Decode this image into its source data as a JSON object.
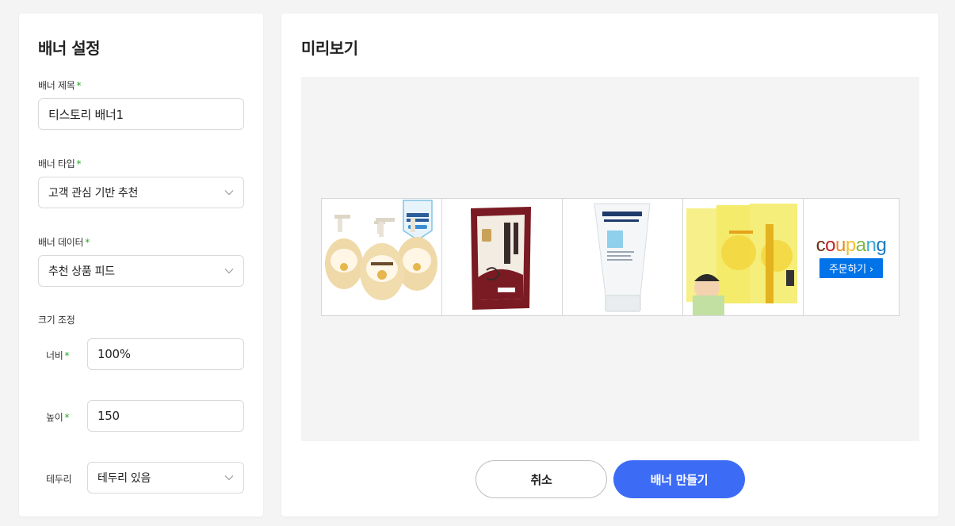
{
  "settings": {
    "title": "배너 설정",
    "banner_title": {
      "label": "배너 제목",
      "required": "*",
      "value": "티스토리 배너1"
    },
    "banner_type": {
      "label": "배너 타입",
      "required": "*",
      "value": "고객 관심 기반 추천"
    },
    "banner_data": {
      "label": "배너 데이터",
      "required": "*",
      "value": "추천 상품 피드"
    },
    "size": {
      "label": "크기 조정",
      "width": {
        "label": "너비",
        "required": "*",
        "value": "100%"
      },
      "height": {
        "label": "높이",
        "required": "*",
        "value": "150"
      }
    },
    "border": {
      "label": "테두리",
      "value": "테두리 있음"
    }
  },
  "preview": {
    "title": "미리보기",
    "products": [
      {
        "icon": "hand-soap-product-image"
      },
      {
        "icon": "rice-bag-product-image"
      },
      {
        "icon": "face-cream-tube-product-image"
      },
      {
        "icon": "supplement-box-product-image"
      }
    ],
    "brand": {
      "logo_letters": [
        "c",
        "o",
        "u",
        "p",
        "a",
        "n",
        "g"
      ],
      "logo_colors": [
        "#6b2e0f",
        "#c22026",
        "#e98b22",
        "#f2c230",
        "#7bb545",
        "#3fa9d8",
        "#1a7ac2"
      ],
      "order_label": "주문하기 ›"
    }
  },
  "actions": {
    "cancel_label": "취소",
    "create_label": "배너 만들기"
  },
  "colors": {
    "accent": "#3c6cf6",
    "required_mark": "#22a722",
    "coupang_blue": "#0073e9"
  }
}
